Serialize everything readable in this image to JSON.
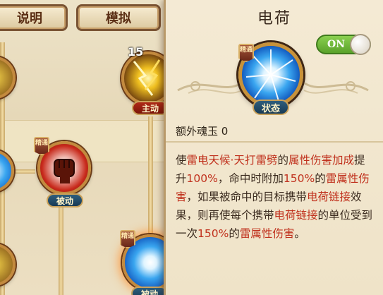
{
  "top_buttons": {
    "explain": "说明",
    "simulate": "模拟"
  },
  "tree": {
    "nodes": [
      {
        "tag": "主动",
        "level": "15"
      },
      {
        "tag": "被动",
        "badge": "精通"
      },
      {
        "tag": "被动",
        "badge": "精通"
      }
    ]
  },
  "panel": {
    "title": "电荷",
    "toggle": "ON",
    "icon": "lightning-orb-icon",
    "badge": "精通",
    "state": "状态",
    "extra": "额外魂玉 0",
    "desc": [
      {
        "t": "使",
        "hl": false
      },
      {
        "t": "雷电天候·天打雷劈",
        "hl": true
      },
      {
        "t": "的",
        "hl": false
      },
      {
        "t": "属性伤害加成",
        "hl": true
      },
      {
        "t": "提升",
        "hl": false
      },
      {
        "t": "100%",
        "hl": true
      },
      {
        "t": "，命中时附加",
        "hl": false
      },
      {
        "t": "150%",
        "hl": true
      },
      {
        "t": "的",
        "hl": false
      },
      {
        "t": "雷属性伤害",
        "hl": true
      },
      {
        "t": "，如果被命中的目标携带",
        "hl": false
      },
      {
        "t": "电荷链接",
        "hl": true
      },
      {
        "t": "效果，则再使每个携带",
        "hl": false
      },
      {
        "t": "电荷链接",
        "hl": true
      },
      {
        "t": "的单位受到一次",
        "hl": false
      },
      {
        "t": "150%",
        "hl": true
      },
      {
        "t": "的",
        "hl": false
      },
      {
        "t": "雷属性伤害",
        "hl": true
      },
      {
        "t": "。",
        "hl": false
      }
    ]
  },
  "colors": {
    "highlight": "#c0301c",
    "toggle_on": "#6ab83a",
    "text": "#3a2a1e"
  }
}
